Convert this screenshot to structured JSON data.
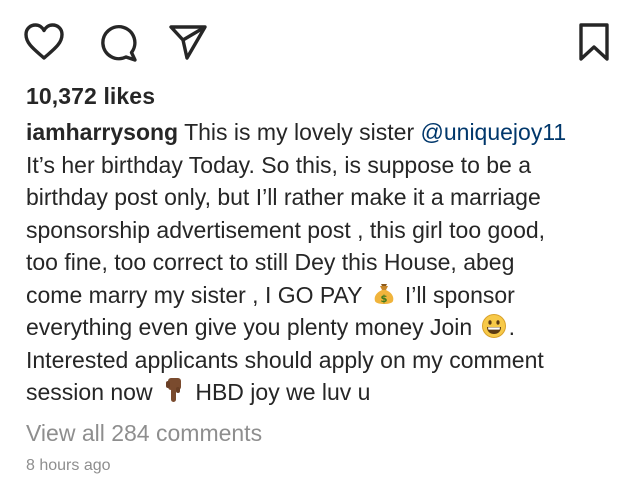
{
  "actions": {
    "like_icon": "heart-icon",
    "comment_icon": "comment-bubble-icon",
    "share_icon": "paper-plane-icon",
    "save_icon": "bookmark-icon"
  },
  "post": {
    "likes": "10,372 likes",
    "username": "iamharrysong",
    "caption": {
      "line1_text": " This is my lovely sister ",
      "mention": "@uniquejoy11",
      "line2": "It’s her birthday Today. So this, is suppose to be a",
      "line3": "birthday post only, but I’ll rather make it a marriage",
      "line4": "sponsorship advertisement post , this girl too good,",
      "line5": "too fine, too correct to still Dey  this House, abeg",
      "line6_before": "come marry my sister , I GO PAY ",
      "line6_after": " I’ll sponsor",
      "line7_before": "everything even give you plenty money Join ",
      "line7_after": ".",
      "line8": "Interested applicants should apply on my comment",
      "line9_before": "session now ",
      "line9_after": " HBD joy we luv u"
    },
    "emojis": {
      "money_bag": "money-bag-emoji",
      "grin": "grinning-face-emoji",
      "point_down": "pointing-down-emoji"
    },
    "view_comments": "View all 284 comments",
    "timestamp": "8 hours ago"
  },
  "colors": {
    "text": "#262626",
    "mention": "#00376b",
    "secondary": "#8e8e8e"
  }
}
